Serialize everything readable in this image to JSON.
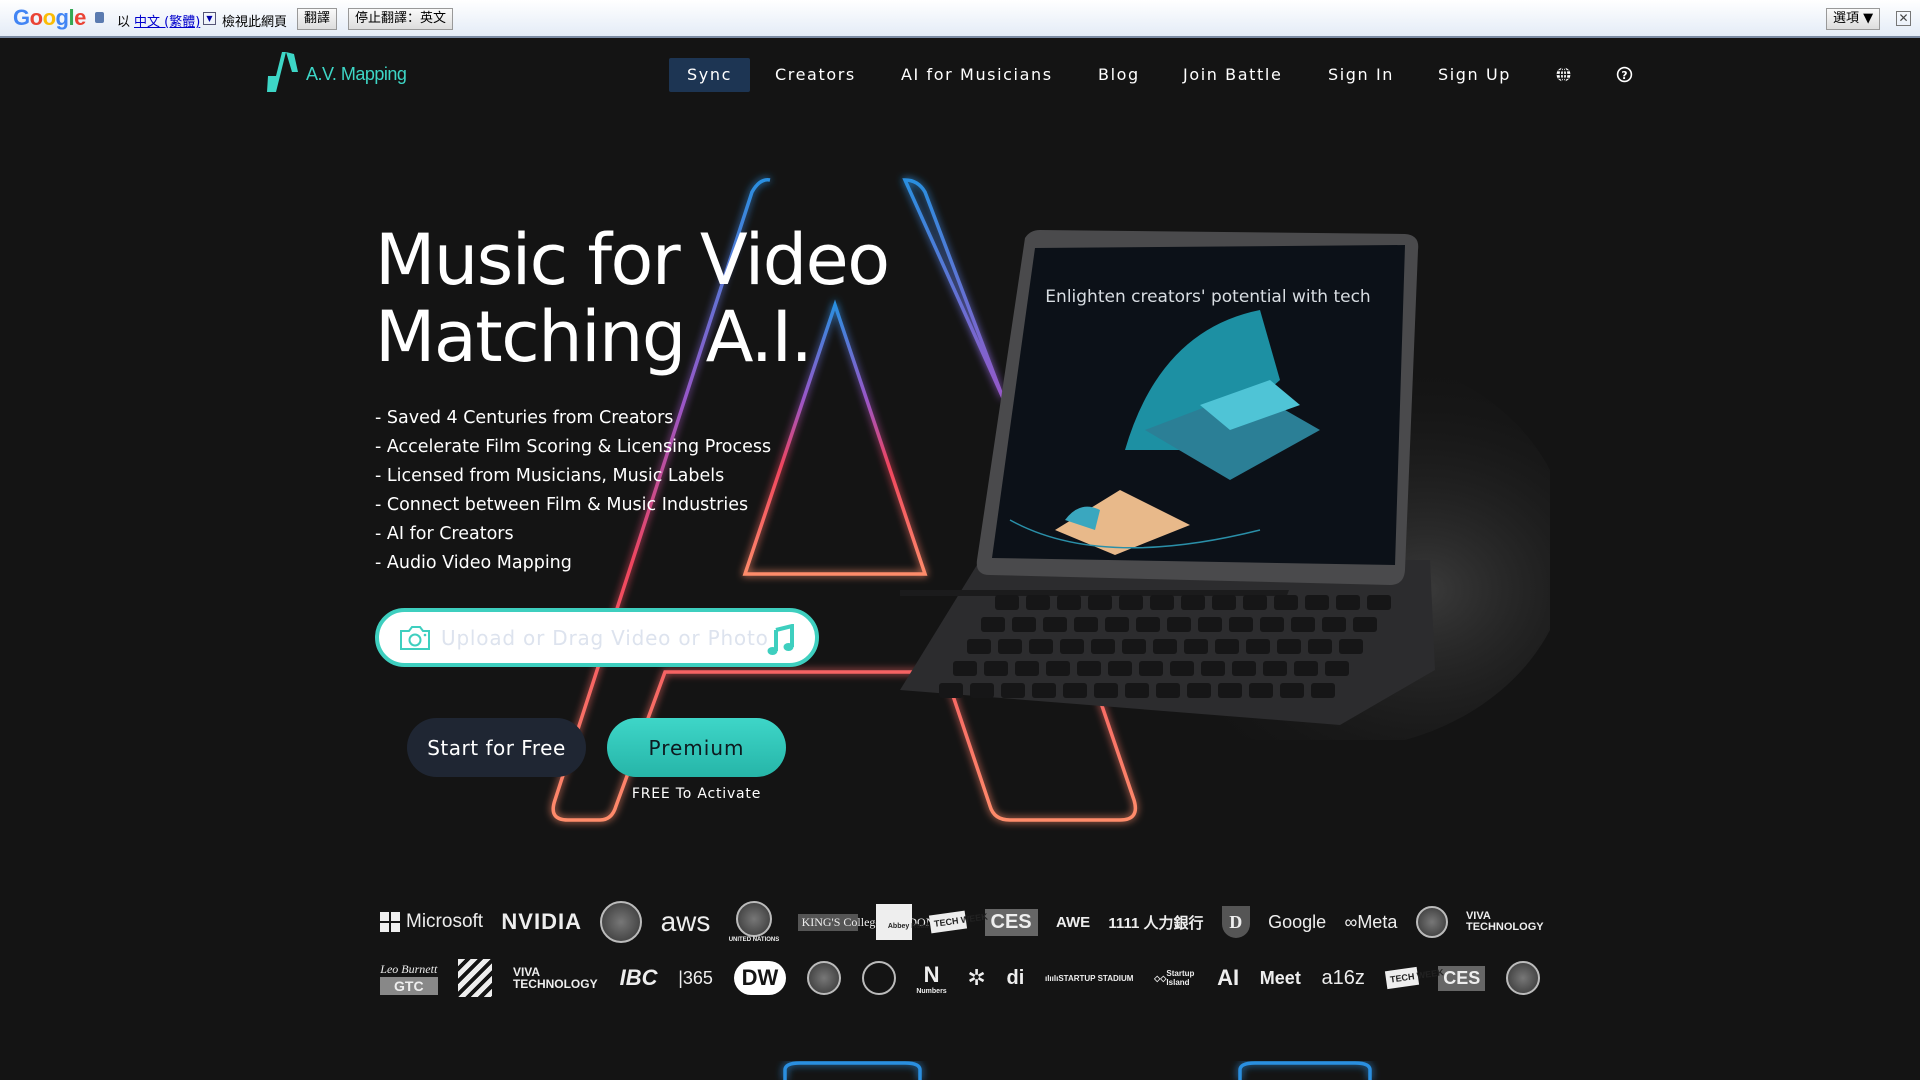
{
  "translate_bar": {
    "brand": "Google",
    "prefix": "以",
    "language": "中文 (繁體)",
    "view_text": "檢視此網頁",
    "translate_button": "翻譯",
    "stop_button": "停止翻譯：英文",
    "options_button": "選項 ▼",
    "close": "✕"
  },
  "header": {
    "logo_text": "A.V. Mapping",
    "nav": [
      {
        "label": "Sync",
        "active": true
      },
      {
        "label": "Creators"
      },
      {
        "label": "AI for Musicians"
      },
      {
        "label": "Blog"
      },
      {
        "label": "Join Battle"
      },
      {
        "label": "Sign In"
      },
      {
        "label": "Sign Up"
      }
    ],
    "icons": [
      "globe-icon",
      "help-icon"
    ]
  },
  "hero": {
    "title_line1": "Music for Video",
    "title_line2": "Matching A.I.",
    "bullets": [
      "- Saved 4 Centuries from Creators",
      "- Accelerate Film Scoring & Licensing Process",
      "- Licensed from Musicians, Music Labels",
      "- Connect between Film & Music Industries",
      "- AI for Creators",
      "- Audio Video Mapping"
    ],
    "upload_placeholder": "Upload or Drag Video or Photo",
    "start_button": "Start for Free",
    "premium_button": "Premium",
    "premium_note": "FREE To Activate",
    "tablet_caption": "Enlighten creators' potential with tech"
  },
  "colors": {
    "accent": "#3ecfbf",
    "nav_active": "#1d3553",
    "background": "#141414"
  },
  "partners": {
    "row1": [
      "Microsoft",
      "NVIDIA",
      "US Seal",
      "aws",
      "UNITED NATIONS",
      "KING'S College LONDON",
      "Abbey Road Studios",
      "TECH WEEK",
      "CES",
      "AWE",
      "1111 人力銀行",
      "D",
      "Google",
      "Meta",
      "Seal",
      "VIVA TECHNOLOGY"
    ],
    "row2": [
      "Leo Burnett",
      "GTC",
      "Flag",
      "VIVA TECHNOLOGY",
      "IBC",
      "365",
      "DW",
      "Seal",
      "Circle",
      "Numbers",
      "Symbol",
      "di",
      "STARTUP STADIUM",
      "Startup Island",
      "AI",
      "Meet",
      "a16z",
      "TECH WEEK",
      "CES",
      "Seal"
    ]
  }
}
